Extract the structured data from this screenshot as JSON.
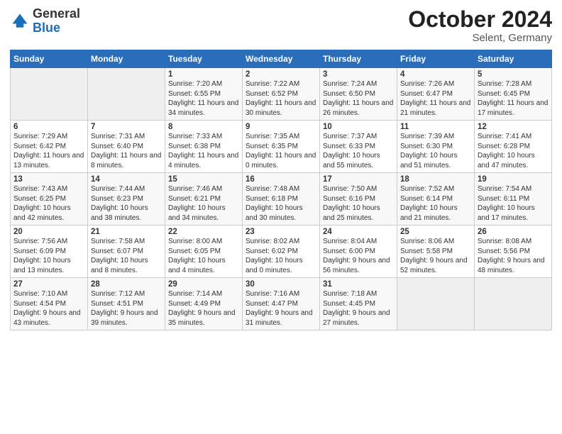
{
  "header": {
    "logo_general": "General",
    "logo_blue": "Blue",
    "month_title": "October 2024",
    "location": "Selent, Germany"
  },
  "days_of_week": [
    "Sunday",
    "Monday",
    "Tuesday",
    "Wednesday",
    "Thursday",
    "Friday",
    "Saturday"
  ],
  "weeks": [
    [
      {
        "day": "",
        "info": ""
      },
      {
        "day": "",
        "info": ""
      },
      {
        "day": "1",
        "info": "Sunrise: 7:20 AM\nSunset: 6:55 PM\nDaylight: 11 hours\nand 34 minutes."
      },
      {
        "day": "2",
        "info": "Sunrise: 7:22 AM\nSunset: 6:52 PM\nDaylight: 11 hours\nand 30 minutes."
      },
      {
        "day": "3",
        "info": "Sunrise: 7:24 AM\nSunset: 6:50 PM\nDaylight: 11 hours\nand 26 minutes."
      },
      {
        "day": "4",
        "info": "Sunrise: 7:26 AM\nSunset: 6:47 PM\nDaylight: 11 hours\nand 21 minutes."
      },
      {
        "day": "5",
        "info": "Sunrise: 7:28 AM\nSunset: 6:45 PM\nDaylight: 11 hours\nand 17 minutes."
      }
    ],
    [
      {
        "day": "6",
        "info": "Sunrise: 7:29 AM\nSunset: 6:42 PM\nDaylight: 11 hours\nand 13 minutes."
      },
      {
        "day": "7",
        "info": "Sunrise: 7:31 AM\nSunset: 6:40 PM\nDaylight: 11 hours\nand 8 minutes."
      },
      {
        "day": "8",
        "info": "Sunrise: 7:33 AM\nSunset: 6:38 PM\nDaylight: 11 hours\nand 4 minutes."
      },
      {
        "day": "9",
        "info": "Sunrise: 7:35 AM\nSunset: 6:35 PM\nDaylight: 11 hours\nand 0 minutes."
      },
      {
        "day": "10",
        "info": "Sunrise: 7:37 AM\nSunset: 6:33 PM\nDaylight: 10 hours\nand 55 minutes."
      },
      {
        "day": "11",
        "info": "Sunrise: 7:39 AM\nSunset: 6:30 PM\nDaylight: 10 hours\nand 51 minutes."
      },
      {
        "day": "12",
        "info": "Sunrise: 7:41 AM\nSunset: 6:28 PM\nDaylight: 10 hours\nand 47 minutes."
      }
    ],
    [
      {
        "day": "13",
        "info": "Sunrise: 7:43 AM\nSunset: 6:25 PM\nDaylight: 10 hours\nand 42 minutes."
      },
      {
        "day": "14",
        "info": "Sunrise: 7:44 AM\nSunset: 6:23 PM\nDaylight: 10 hours\nand 38 minutes."
      },
      {
        "day": "15",
        "info": "Sunrise: 7:46 AM\nSunset: 6:21 PM\nDaylight: 10 hours\nand 34 minutes."
      },
      {
        "day": "16",
        "info": "Sunrise: 7:48 AM\nSunset: 6:18 PM\nDaylight: 10 hours\nand 30 minutes."
      },
      {
        "day": "17",
        "info": "Sunrise: 7:50 AM\nSunset: 6:16 PM\nDaylight: 10 hours\nand 25 minutes."
      },
      {
        "day": "18",
        "info": "Sunrise: 7:52 AM\nSunset: 6:14 PM\nDaylight: 10 hours\nand 21 minutes."
      },
      {
        "day": "19",
        "info": "Sunrise: 7:54 AM\nSunset: 6:11 PM\nDaylight: 10 hours\nand 17 minutes."
      }
    ],
    [
      {
        "day": "20",
        "info": "Sunrise: 7:56 AM\nSunset: 6:09 PM\nDaylight: 10 hours\nand 13 minutes."
      },
      {
        "day": "21",
        "info": "Sunrise: 7:58 AM\nSunset: 6:07 PM\nDaylight: 10 hours\nand 8 minutes."
      },
      {
        "day": "22",
        "info": "Sunrise: 8:00 AM\nSunset: 6:05 PM\nDaylight: 10 hours\nand 4 minutes."
      },
      {
        "day": "23",
        "info": "Sunrise: 8:02 AM\nSunset: 6:02 PM\nDaylight: 10 hours\nand 0 minutes."
      },
      {
        "day": "24",
        "info": "Sunrise: 8:04 AM\nSunset: 6:00 PM\nDaylight: 9 hours\nand 56 minutes."
      },
      {
        "day": "25",
        "info": "Sunrise: 8:06 AM\nSunset: 5:58 PM\nDaylight: 9 hours\nand 52 minutes."
      },
      {
        "day": "26",
        "info": "Sunrise: 8:08 AM\nSunset: 5:56 PM\nDaylight: 9 hours\nand 48 minutes."
      }
    ],
    [
      {
        "day": "27",
        "info": "Sunrise: 7:10 AM\nSunset: 4:54 PM\nDaylight: 9 hours\nand 43 minutes."
      },
      {
        "day": "28",
        "info": "Sunrise: 7:12 AM\nSunset: 4:51 PM\nDaylight: 9 hours\nand 39 minutes."
      },
      {
        "day": "29",
        "info": "Sunrise: 7:14 AM\nSunset: 4:49 PM\nDaylight: 9 hours\nand 35 minutes."
      },
      {
        "day": "30",
        "info": "Sunrise: 7:16 AM\nSunset: 4:47 PM\nDaylight: 9 hours\nand 31 minutes."
      },
      {
        "day": "31",
        "info": "Sunrise: 7:18 AM\nSunset: 4:45 PM\nDaylight: 9 hours\nand 27 minutes."
      },
      {
        "day": "",
        "info": ""
      },
      {
        "day": "",
        "info": ""
      }
    ]
  ]
}
